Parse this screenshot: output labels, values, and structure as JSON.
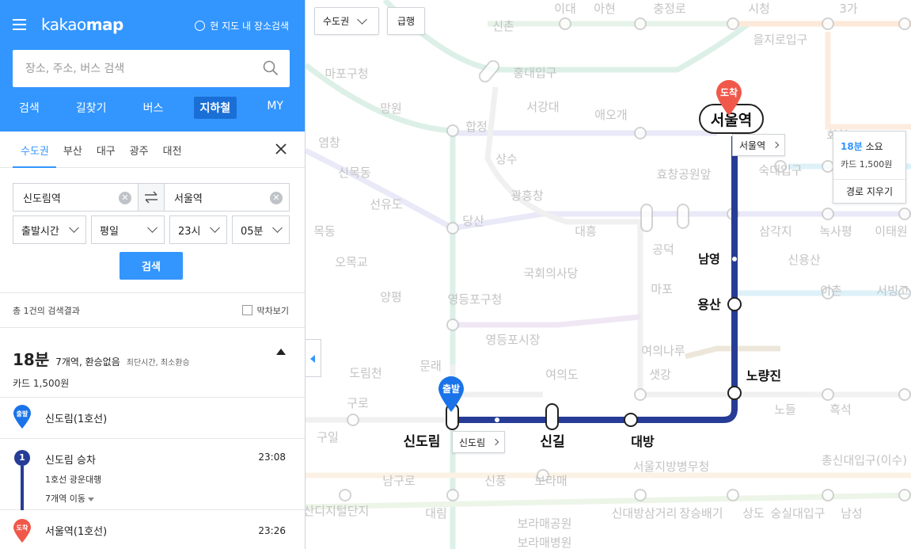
{
  "header": {
    "logo_light": "kakao",
    "logo_bold": "map",
    "here_search": "현 지도 내 장소검색",
    "search_placeholder": "장소, 주소, 버스 검색",
    "nav": [
      "검색",
      "길찾기",
      "버스",
      "지하철",
      "MY"
    ],
    "nav_active": "지하철"
  },
  "regions": [
    "수도권",
    "부산",
    "대구",
    "광주",
    "대전"
  ],
  "route": {
    "from": "신도림역",
    "to": "서울역",
    "time_mode": "출발시간",
    "day_type": "평일",
    "hour": "23시",
    "minute": "05분",
    "search_label": "검색"
  },
  "results": {
    "count_text": "총 1건의 검색결과",
    "last_train_label": "막차보기"
  },
  "summary": {
    "time": "18분",
    "info": "7개역, 환승없음",
    "tags": "최단시간, 최소환승",
    "fare": "카드 1,500원"
  },
  "steps": {
    "start_badge": "출발",
    "start_station": "신도림(1호선)",
    "line_number": "1",
    "board_title": "신도림 승차",
    "board_time": "23:08",
    "board_line": "1호선 광운대행",
    "board_more": "7개역 이동",
    "end_badge": "도착",
    "end_station": "서울역(1호선)",
    "end_time": "23:26"
  },
  "map": {
    "region_select": "수도권",
    "express_label": "급행",
    "card_duration": "18분",
    "card_duration_suffix": "소요",
    "card_fare": "카드 1,500원",
    "card_clear": "경로 지우기",
    "dest_tag": "서울역",
    "origin_tag": "신도림",
    "route_line_color": "#263c96",
    "accent": "#3396ff",
    "dest_marker_color": "#f0584a",
    "route_stations": [
      "서울역",
      "남영",
      "용산",
      "노량진",
      "대방",
      "신길",
      "신도림"
    ],
    "bg_labels": [
      "이대",
      "아현",
      "충정로",
      "시청",
      "3가",
      "신촌",
      "을지로입구",
      "마포구청",
      "홍대입구",
      "서강대",
      "애오개",
      "합정",
      "망원",
      "상수",
      "효창공원앞",
      "숙대입구",
      "염창",
      "신목동",
      "선유도",
      "광흥창",
      "회현",
      "목동",
      "당산",
      "대흥",
      "공덕",
      "삼각지",
      "녹사평",
      "이태원",
      "오목교",
      "국회의사당",
      "마포",
      "신용산",
      "양평",
      "영등포구청",
      "이촌",
      "서빙고",
      "영등포시장",
      "여의나루",
      "도림천",
      "문래",
      "여의도",
      "샛강",
      "구로",
      "노들",
      "흑석",
      "구일",
      "신풍",
      "보라매",
      "서울지방병무청",
      "총신대입구(이수)",
      "남구로",
      "가산디지털단지",
      "대림",
      "신대방삼거리",
      "장승배기",
      "상도",
      "숭실대입구",
      "남성",
      "보라매공원",
      "보라매병원"
    ]
  }
}
